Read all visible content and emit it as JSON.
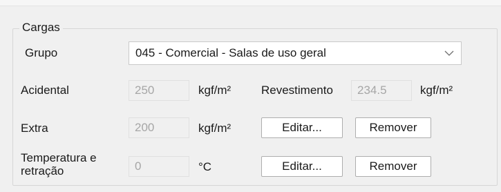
{
  "cargas": {
    "title": "Cargas",
    "grupo": {
      "label": "Grupo",
      "selected": "045 - Comercial - Salas de uso geral",
      "chevron_icon": "chevron-down-icon"
    },
    "acidental": {
      "label": "Acidental",
      "value": "250",
      "unit": "kgf/m²"
    },
    "revestimento": {
      "label": "Revestimento",
      "value": "234.5",
      "unit": "kgf/m²"
    },
    "extra": {
      "label": "Extra",
      "value": "200",
      "unit": "kgf/m²",
      "edit_label": "Editar...",
      "remove_label": "Remover"
    },
    "temperatura": {
      "label": "Temperatura e retração",
      "value": "0",
      "unit": "°C",
      "edit_label": "Editar...",
      "remove_label": "Remover"
    }
  },
  "colors": {
    "window_bg": "#f0f0f0",
    "disabled_text": "#a6a6a6",
    "button_border": "#adadad"
  }
}
